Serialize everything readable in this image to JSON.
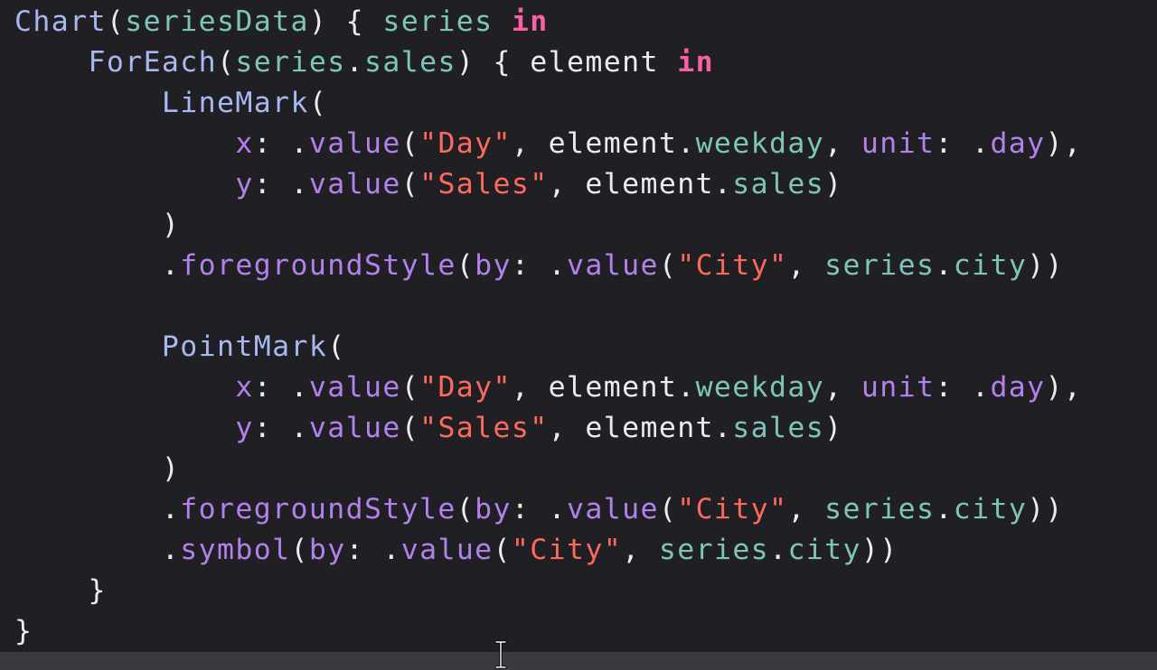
{
  "editor": {
    "lines": [
      {
        "indent": 0,
        "tokens": [
          {
            "t": "Chart",
            "c": "fn"
          },
          {
            "t": "(",
            "c": "plain"
          },
          {
            "t": "seriesData",
            "c": "var"
          },
          {
            "t": ") { ",
            "c": "plain"
          },
          {
            "t": "series",
            "c": "var"
          },
          {
            "t": " ",
            "c": "plain"
          },
          {
            "t": "in",
            "c": "kw"
          }
        ]
      },
      {
        "indent": 4,
        "tokens": [
          {
            "t": "ForEach",
            "c": "fn"
          },
          {
            "t": "(",
            "c": "plain"
          },
          {
            "t": "series",
            "c": "var"
          },
          {
            "t": ".",
            "c": "plain"
          },
          {
            "t": "sales",
            "c": "var"
          },
          {
            "t": ") { element ",
            "c": "plain"
          },
          {
            "t": "in",
            "c": "kw"
          }
        ]
      },
      {
        "indent": 8,
        "tokens": [
          {
            "t": "LineMark",
            "c": "fn"
          },
          {
            "t": "(",
            "c": "plain"
          }
        ]
      },
      {
        "indent": 12,
        "tokens": [
          {
            "t": "x",
            "c": "param"
          },
          {
            "t": ": .",
            "c": "plain"
          },
          {
            "t": "value",
            "c": "param"
          },
          {
            "t": "(",
            "c": "plain"
          },
          {
            "t": "\"Day\"",
            "c": "str"
          },
          {
            "t": ", element.",
            "c": "plain"
          },
          {
            "t": "weekday",
            "c": "var"
          },
          {
            "t": ", ",
            "c": "plain"
          },
          {
            "t": "unit",
            "c": "param"
          },
          {
            "t": ": .",
            "c": "plain"
          },
          {
            "t": "day",
            "c": "param"
          },
          {
            "t": "),",
            "c": "plain"
          }
        ]
      },
      {
        "indent": 12,
        "tokens": [
          {
            "t": "y",
            "c": "param"
          },
          {
            "t": ": .",
            "c": "plain"
          },
          {
            "t": "value",
            "c": "param"
          },
          {
            "t": "(",
            "c": "plain"
          },
          {
            "t": "\"Sales\"",
            "c": "str"
          },
          {
            "t": ", element.",
            "c": "plain"
          },
          {
            "t": "sales",
            "c": "var"
          },
          {
            "t": ")",
            "c": "plain"
          }
        ]
      },
      {
        "indent": 8,
        "tokens": [
          {
            "t": ")",
            "c": "plain"
          }
        ]
      },
      {
        "indent": 8,
        "tokens": [
          {
            "t": ".",
            "c": "plain"
          },
          {
            "t": "foregroundStyle",
            "c": "param"
          },
          {
            "t": "(",
            "c": "plain"
          },
          {
            "t": "by",
            "c": "param"
          },
          {
            "t": ": .",
            "c": "plain"
          },
          {
            "t": "value",
            "c": "param"
          },
          {
            "t": "(",
            "c": "plain"
          },
          {
            "t": "\"City\"",
            "c": "str"
          },
          {
            "t": ", ",
            "c": "plain"
          },
          {
            "t": "series",
            "c": "var"
          },
          {
            "t": ".",
            "c": "plain"
          },
          {
            "t": "city",
            "c": "var"
          },
          {
            "t": "))",
            "c": "plain"
          }
        ]
      },
      {
        "indent": 0,
        "tokens": []
      },
      {
        "indent": 8,
        "tokens": [
          {
            "t": "PointMark",
            "c": "fn"
          },
          {
            "t": "(",
            "c": "plain"
          }
        ]
      },
      {
        "indent": 12,
        "tokens": [
          {
            "t": "x",
            "c": "param"
          },
          {
            "t": ": .",
            "c": "plain"
          },
          {
            "t": "value",
            "c": "param"
          },
          {
            "t": "(",
            "c": "plain"
          },
          {
            "t": "\"Day\"",
            "c": "str"
          },
          {
            "t": ", element.",
            "c": "plain"
          },
          {
            "t": "weekday",
            "c": "var"
          },
          {
            "t": ", ",
            "c": "plain"
          },
          {
            "t": "unit",
            "c": "param"
          },
          {
            "t": ": .",
            "c": "plain"
          },
          {
            "t": "day",
            "c": "param"
          },
          {
            "t": "),",
            "c": "plain"
          }
        ]
      },
      {
        "indent": 12,
        "tokens": [
          {
            "t": "y",
            "c": "param"
          },
          {
            "t": ": .",
            "c": "plain"
          },
          {
            "t": "value",
            "c": "param"
          },
          {
            "t": "(",
            "c": "plain"
          },
          {
            "t": "\"Sales\"",
            "c": "str"
          },
          {
            "t": ", element.",
            "c": "plain"
          },
          {
            "t": "sales",
            "c": "var"
          },
          {
            "t": ")",
            "c": "plain"
          }
        ]
      },
      {
        "indent": 8,
        "tokens": [
          {
            "t": ")",
            "c": "plain"
          }
        ]
      },
      {
        "indent": 8,
        "tokens": [
          {
            "t": ".",
            "c": "plain"
          },
          {
            "t": "foregroundStyle",
            "c": "param"
          },
          {
            "t": "(",
            "c": "plain"
          },
          {
            "t": "by",
            "c": "param"
          },
          {
            "t": ": .",
            "c": "plain"
          },
          {
            "t": "value",
            "c": "param"
          },
          {
            "t": "(",
            "c": "plain"
          },
          {
            "t": "\"City\"",
            "c": "str"
          },
          {
            "t": ", ",
            "c": "plain"
          },
          {
            "t": "series",
            "c": "var"
          },
          {
            "t": ".",
            "c": "plain"
          },
          {
            "t": "city",
            "c": "var"
          },
          {
            "t": "))",
            "c": "plain"
          }
        ]
      },
      {
        "indent": 8,
        "tokens": [
          {
            "t": ".",
            "c": "plain"
          },
          {
            "t": "symbol",
            "c": "param"
          },
          {
            "t": "(",
            "c": "plain"
          },
          {
            "t": "by",
            "c": "param"
          },
          {
            "t": ": .",
            "c": "plain"
          },
          {
            "t": "value",
            "c": "param"
          },
          {
            "t": "(",
            "c": "plain"
          },
          {
            "t": "\"City\"",
            "c": "str"
          },
          {
            "t": ", ",
            "c": "plain"
          },
          {
            "t": "series",
            "c": "var"
          },
          {
            "t": ".",
            "c": "plain"
          },
          {
            "t": "city",
            "c": "var"
          },
          {
            "t": "))",
            "c": "plain"
          }
        ]
      },
      {
        "indent": 4,
        "tokens": [
          {
            "t": "}",
            "c": "plain"
          }
        ]
      },
      {
        "indent": 0,
        "tokens": [
          {
            "t": "}",
            "c": "plain"
          }
        ]
      }
    ]
  },
  "theme": {
    "background": "#1f1f24",
    "plain": "#ececec",
    "function": "#a8b8f0",
    "variable": "#7ec4b9",
    "keyword": "#fc5fa3",
    "string": "#fc6a5d",
    "parameter": "#b281eb"
  },
  "cursor_icon": "i-beam-cursor-icon"
}
